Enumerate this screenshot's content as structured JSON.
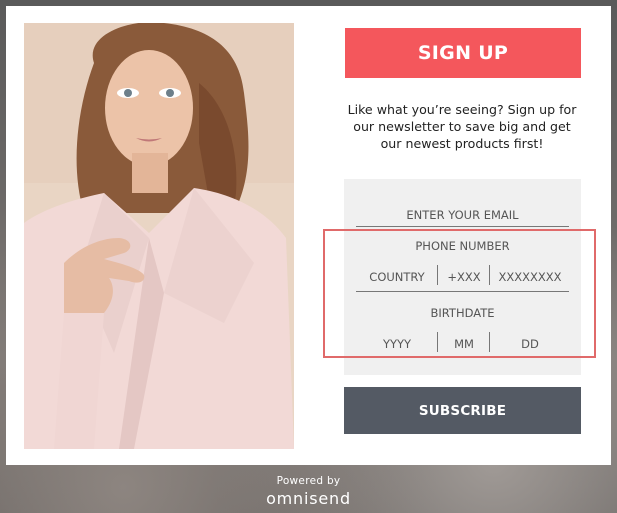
{
  "signup": {
    "title": "SIGN UP"
  },
  "intro": {
    "line1": "Like what you’re seeing? Sign up for",
    "line2": "our newsletter to save big and get",
    "line3": "our newest products first!"
  },
  "form": {
    "email_placeholder": "ENTER YOUR EMAIL",
    "phone_label": "PHONE NUMBER",
    "phone_country_placeholder": "COUNTRY",
    "phone_code_placeholder": "+XXX",
    "phone_number_placeholder": "XXXXXXXX",
    "birthdate_label": "BIRTHDATE",
    "year_placeholder": "YYYY",
    "month_placeholder": "MM",
    "day_placeholder": "DD",
    "submit_label": "SUBSCRIBE"
  },
  "footer": {
    "powered_by": "Powered by",
    "brand": "omnisend"
  },
  "colors": {
    "signup_bg": "#f4575c",
    "subscribe_bg": "#545a64",
    "form_bg": "#f0f0f0",
    "highlight": "#e06a6a"
  }
}
